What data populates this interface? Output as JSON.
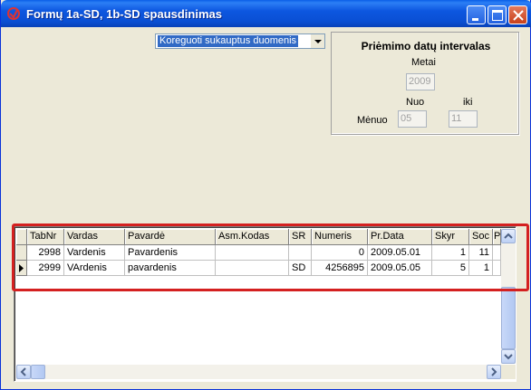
{
  "window": {
    "title": "Formų 1a-SD, 1b-SD spausdinimas"
  },
  "mode_select": {
    "value": "Koreguoti sukauptus duomenis"
  },
  "date_range": {
    "title": "Priėmimo datų intervalas",
    "year_label": "Metai",
    "year_value": "2009",
    "from_label": "Nuo",
    "to_label": "iki",
    "month_label": "Mėnuo",
    "from_value": "05",
    "to_value": "11"
  },
  "grid": {
    "columns": [
      "TabNr",
      "Vardas",
      "Pavardė",
      "Asm.Kodas",
      "SR",
      "Numeris",
      "Pr.Data",
      "Skyr",
      "Soc",
      "P"
    ],
    "rows": [
      {
        "TabNr": "2998",
        "Vardas": "Vardenis",
        "Pavarde": "Pavardenis",
        "AsmKodas": "",
        "SR": "",
        "Numeris": "0",
        "PrData": "2009.05.01",
        "Skyr": "1",
        "Soc": "11"
      },
      {
        "TabNr": "2999",
        "Vardas": "VArdenis",
        "Pavarde": "pavardenis",
        "AsmKodas": "",
        "SR": "SD",
        "Numeris": "4256895",
        "PrData": "2009.05.05",
        "Skyr": "5",
        "Soc": "1"
      }
    ]
  },
  "icons": [
    "app-icon",
    "minimize-icon",
    "maximize-icon",
    "close-icon",
    "dropdown-arrow-icon",
    "row-pointer-icon",
    "scroll-up-icon",
    "scroll-down-icon",
    "scroll-left-icon",
    "scroll-right-icon"
  ],
  "colors": {
    "titlebar": "#0a4fd3",
    "highlight": "#d42020",
    "selection": "#316ac5"
  }
}
